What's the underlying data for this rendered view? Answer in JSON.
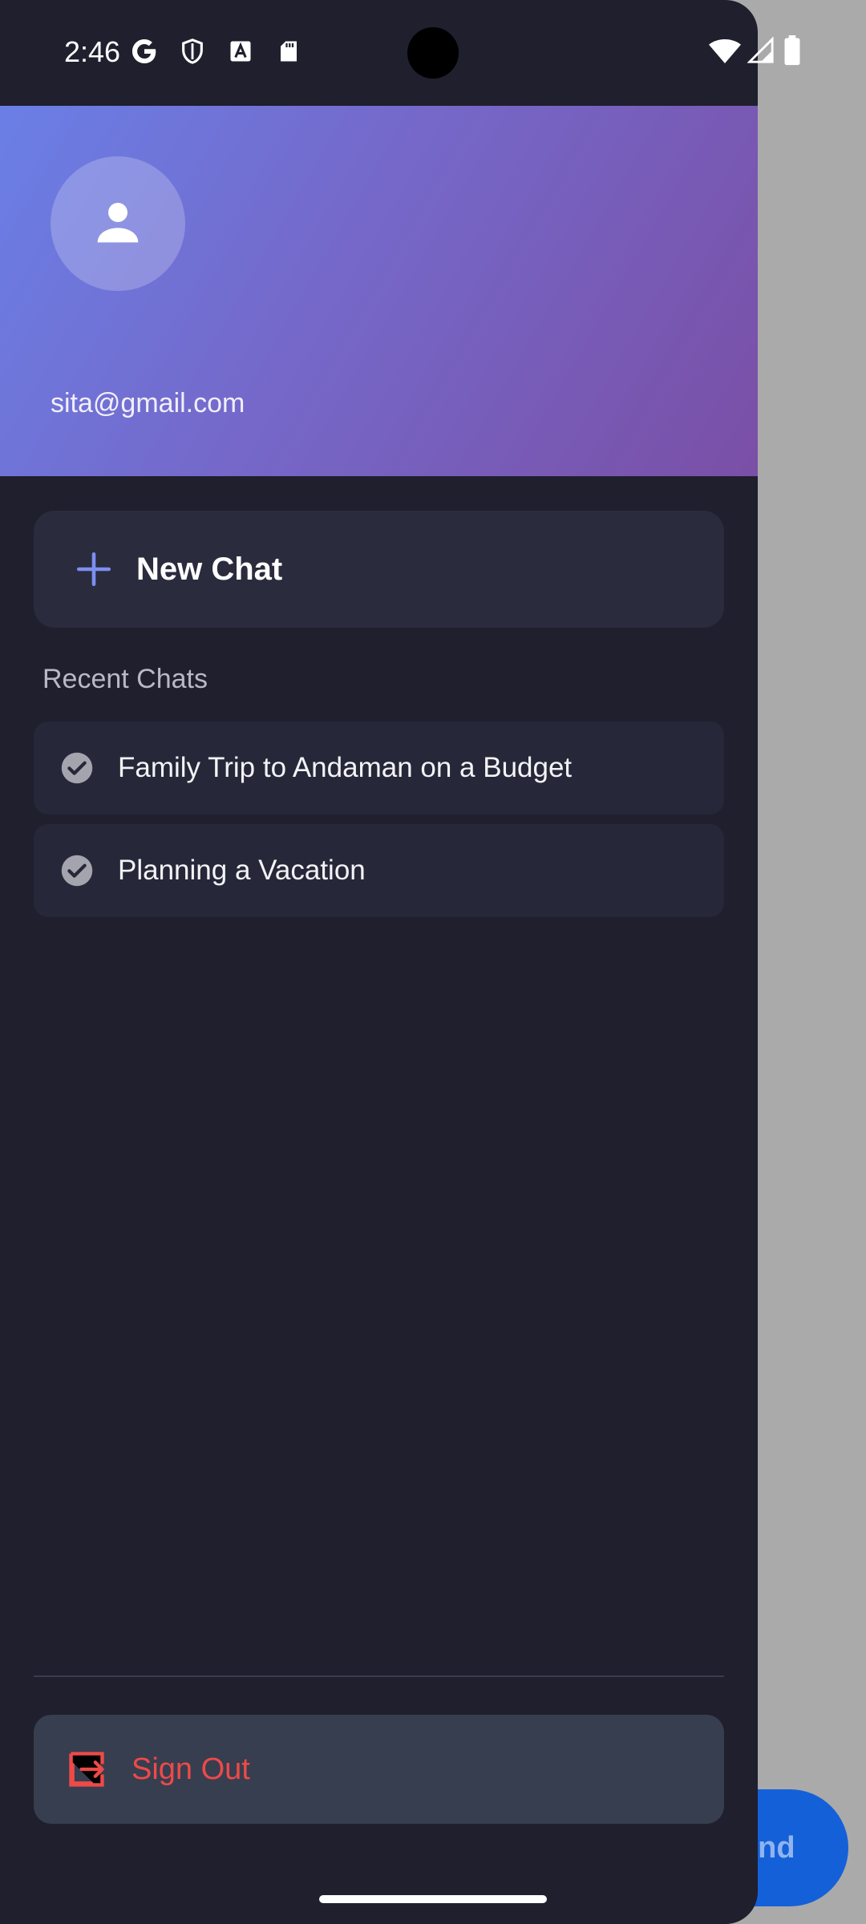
{
  "status_bar": {
    "time": "2:46",
    "left_icons": [
      "google-icon",
      "shield-icon",
      "font-a-icon",
      "sd-card-icon"
    ],
    "right_icons": [
      "wifi-icon",
      "signal-icon",
      "battery-icon"
    ]
  },
  "drawer": {
    "header": {
      "avatar_icon": "person-icon",
      "email": "sita@gmail.com"
    },
    "new_chat": {
      "icon": "plus-icon",
      "label": "New Chat"
    },
    "recent_chats": {
      "title": "Recent Chats",
      "items": [
        {
          "icon": "check-circle-icon",
          "title": "Family Trip to Andaman on a Budget"
        },
        {
          "icon": "check-circle-icon",
          "title": "Planning a Vacation"
        }
      ]
    },
    "sign_out": {
      "icon": "sign-out-icon",
      "label": "Sign Out"
    }
  },
  "background": {
    "send_button_partial_label": "end"
  },
  "colors": {
    "drawer_bg": "#1f1f2e",
    "accent": "#6a7fe6",
    "sign_out_red": "#ee4a48",
    "send_blue": "#1460d8"
  }
}
